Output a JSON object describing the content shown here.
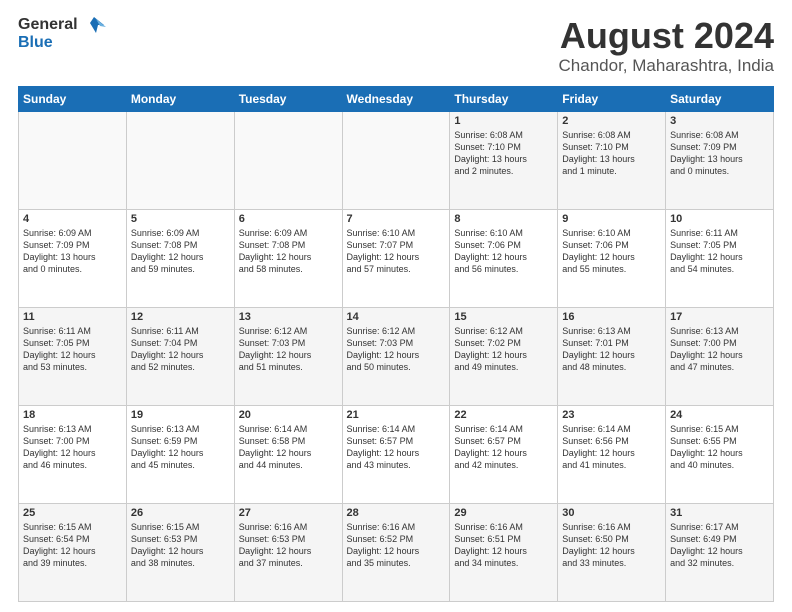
{
  "header": {
    "logo_general": "General",
    "logo_blue": "Blue",
    "main_title": "August 2024",
    "subtitle": "Chandor, Maharashtra, India"
  },
  "days_of_week": [
    "Sunday",
    "Monday",
    "Tuesday",
    "Wednesday",
    "Thursday",
    "Friday",
    "Saturday"
  ],
  "weeks": [
    [
      {
        "day": "",
        "info": ""
      },
      {
        "day": "",
        "info": ""
      },
      {
        "day": "",
        "info": ""
      },
      {
        "day": "",
        "info": ""
      },
      {
        "day": "1",
        "info": "Sunrise: 6:08 AM\nSunset: 7:10 PM\nDaylight: 13 hours\nand 2 minutes."
      },
      {
        "day": "2",
        "info": "Sunrise: 6:08 AM\nSunset: 7:10 PM\nDaylight: 13 hours\nand 1 minute."
      },
      {
        "day": "3",
        "info": "Sunrise: 6:08 AM\nSunset: 7:09 PM\nDaylight: 13 hours\nand 0 minutes."
      }
    ],
    [
      {
        "day": "4",
        "info": "Sunrise: 6:09 AM\nSunset: 7:09 PM\nDaylight: 13 hours\nand 0 minutes."
      },
      {
        "day": "5",
        "info": "Sunrise: 6:09 AM\nSunset: 7:08 PM\nDaylight: 12 hours\nand 59 minutes."
      },
      {
        "day": "6",
        "info": "Sunrise: 6:09 AM\nSunset: 7:08 PM\nDaylight: 12 hours\nand 58 minutes."
      },
      {
        "day": "7",
        "info": "Sunrise: 6:10 AM\nSunset: 7:07 PM\nDaylight: 12 hours\nand 57 minutes."
      },
      {
        "day": "8",
        "info": "Sunrise: 6:10 AM\nSunset: 7:06 PM\nDaylight: 12 hours\nand 56 minutes."
      },
      {
        "day": "9",
        "info": "Sunrise: 6:10 AM\nSunset: 7:06 PM\nDaylight: 12 hours\nand 55 minutes."
      },
      {
        "day": "10",
        "info": "Sunrise: 6:11 AM\nSunset: 7:05 PM\nDaylight: 12 hours\nand 54 minutes."
      }
    ],
    [
      {
        "day": "11",
        "info": "Sunrise: 6:11 AM\nSunset: 7:05 PM\nDaylight: 12 hours\nand 53 minutes."
      },
      {
        "day": "12",
        "info": "Sunrise: 6:11 AM\nSunset: 7:04 PM\nDaylight: 12 hours\nand 52 minutes."
      },
      {
        "day": "13",
        "info": "Sunrise: 6:12 AM\nSunset: 7:03 PM\nDaylight: 12 hours\nand 51 minutes."
      },
      {
        "day": "14",
        "info": "Sunrise: 6:12 AM\nSunset: 7:03 PM\nDaylight: 12 hours\nand 50 minutes."
      },
      {
        "day": "15",
        "info": "Sunrise: 6:12 AM\nSunset: 7:02 PM\nDaylight: 12 hours\nand 49 minutes."
      },
      {
        "day": "16",
        "info": "Sunrise: 6:13 AM\nSunset: 7:01 PM\nDaylight: 12 hours\nand 48 minutes."
      },
      {
        "day": "17",
        "info": "Sunrise: 6:13 AM\nSunset: 7:00 PM\nDaylight: 12 hours\nand 47 minutes."
      }
    ],
    [
      {
        "day": "18",
        "info": "Sunrise: 6:13 AM\nSunset: 7:00 PM\nDaylight: 12 hours\nand 46 minutes."
      },
      {
        "day": "19",
        "info": "Sunrise: 6:13 AM\nSunset: 6:59 PM\nDaylight: 12 hours\nand 45 minutes."
      },
      {
        "day": "20",
        "info": "Sunrise: 6:14 AM\nSunset: 6:58 PM\nDaylight: 12 hours\nand 44 minutes."
      },
      {
        "day": "21",
        "info": "Sunrise: 6:14 AM\nSunset: 6:57 PM\nDaylight: 12 hours\nand 43 minutes."
      },
      {
        "day": "22",
        "info": "Sunrise: 6:14 AM\nSunset: 6:57 PM\nDaylight: 12 hours\nand 42 minutes."
      },
      {
        "day": "23",
        "info": "Sunrise: 6:14 AM\nSunset: 6:56 PM\nDaylight: 12 hours\nand 41 minutes."
      },
      {
        "day": "24",
        "info": "Sunrise: 6:15 AM\nSunset: 6:55 PM\nDaylight: 12 hours\nand 40 minutes."
      }
    ],
    [
      {
        "day": "25",
        "info": "Sunrise: 6:15 AM\nSunset: 6:54 PM\nDaylight: 12 hours\nand 39 minutes."
      },
      {
        "day": "26",
        "info": "Sunrise: 6:15 AM\nSunset: 6:53 PM\nDaylight: 12 hours\nand 38 minutes."
      },
      {
        "day": "27",
        "info": "Sunrise: 6:16 AM\nSunset: 6:53 PM\nDaylight: 12 hours\nand 37 minutes."
      },
      {
        "day": "28",
        "info": "Sunrise: 6:16 AM\nSunset: 6:52 PM\nDaylight: 12 hours\nand 35 minutes."
      },
      {
        "day": "29",
        "info": "Sunrise: 6:16 AM\nSunset: 6:51 PM\nDaylight: 12 hours\nand 34 minutes."
      },
      {
        "day": "30",
        "info": "Sunrise: 6:16 AM\nSunset: 6:50 PM\nDaylight: 12 hours\nand 33 minutes."
      },
      {
        "day": "31",
        "info": "Sunrise: 6:17 AM\nSunset: 6:49 PM\nDaylight: 12 hours\nand 32 minutes."
      }
    ]
  ]
}
